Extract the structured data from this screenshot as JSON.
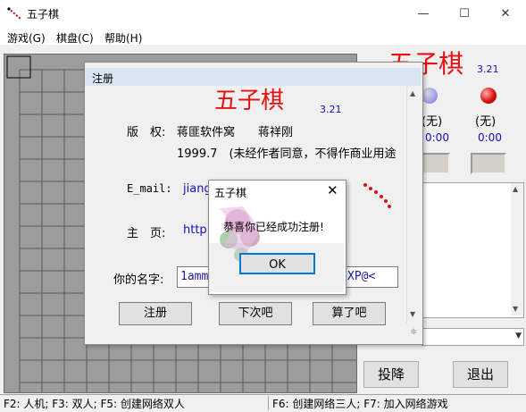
{
  "window": {
    "title": "五子棋"
  },
  "menu": [
    "游戏(G)",
    "棋盘(C)",
    "帮助(H)"
  ],
  "right_panel": {
    "logo": "五子棋",
    "version": "3.21",
    "p1_state": "(无)",
    "p2_state": "(无)",
    "p1_time": "0:00",
    "p2_time": "0:00",
    "surrender": "投降",
    "exit": "退出"
  },
  "status": {
    "left": "F2: 人机; F3: 双人; F5: 创建网络双人",
    "right": "F6: 创建网络三人; F7: 加入网络游戏"
  },
  "register_dialog": {
    "title": "注册",
    "logo": "五子棋",
    "version": "3.21",
    "copyright_label": "版　权:",
    "copyright_value": "蒋匪软件窝　　蒋祥刚",
    "year_line": "1999.7　(未经作者同意，不得作商业用途",
    "email_label": "E_mail:",
    "email_value": "jiang",
    "homepage_label": "主　页:",
    "homepage_value": "http",
    "name_label": "你的名字:",
    "name_value": "1ammm",
    "name_value_tail": "XP@<",
    "btn_register": "注册",
    "btn_later": "下次吧",
    "btn_cancel": "算了吧"
  },
  "message_box": {
    "title": "五子棋",
    "text": "恭喜你已经成功注册!",
    "ok": "OK"
  }
}
